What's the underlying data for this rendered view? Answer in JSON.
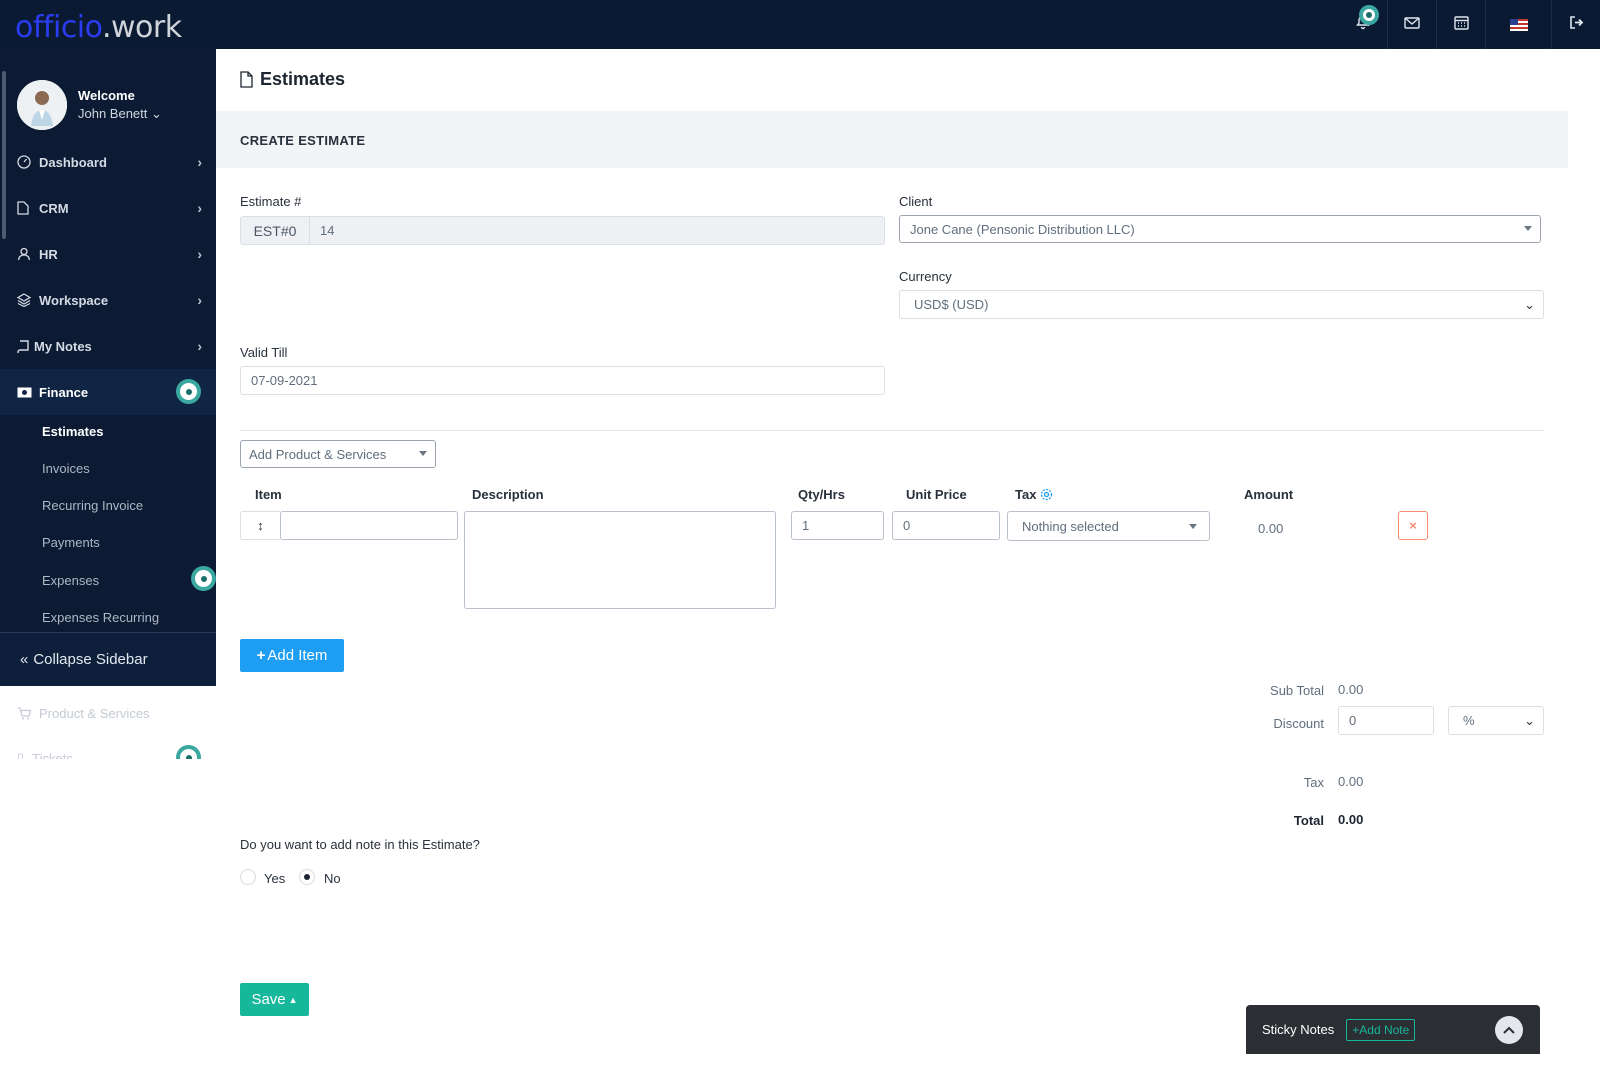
{
  "brand": {
    "logo_part1": "officio",
    "logo_part2": ".work"
  },
  "topbar": {
    "icons": [
      "bell-icon",
      "mail-icon",
      "calendar-icon",
      "us-flag-icon",
      "logout-icon"
    ]
  },
  "user": {
    "welcome": "Welcome",
    "name": "John Benett"
  },
  "sidebar": {
    "items": [
      {
        "label": "Dashboard",
        "icon": "gauge-icon"
      },
      {
        "label": "CRM",
        "icon": "file-icon"
      },
      {
        "label": "HR",
        "icon": "user-icon"
      },
      {
        "label": "Workspace",
        "icon": "layers-icon"
      },
      {
        "label": "My Notes",
        "icon": "book-icon"
      },
      {
        "label": "Finance",
        "icon": "money-icon"
      }
    ],
    "finance_sub": [
      "Estimates",
      "Invoices",
      "Recurring Invoice",
      "Payments",
      "Expenses",
      "Expenses Recurring"
    ],
    "collapse_label": "Collapse Sidebar",
    "below": [
      {
        "label": "Product & Services",
        "icon": "cart-icon"
      },
      {
        "label": "Tickets",
        "icon": "ticket-icon"
      }
    ]
  },
  "page": {
    "title": "Estimates",
    "section": "CREATE ESTIMATE"
  },
  "form": {
    "estimate_label": "Estimate #",
    "estimate_prefix": "EST#0",
    "estimate_number": "14",
    "client_label": "Client",
    "client_value": "Jone Cane (Pensonic Distribution LLC)",
    "currency_label": "Currency",
    "currency_value": "USD$ (USD)",
    "valid_till_label": "Valid Till",
    "valid_till_value": "07-09-2021",
    "add_product_placeholder": "Add Product & Services"
  },
  "items_table": {
    "headers": {
      "item": "Item",
      "description": "Description",
      "qty": "Qty/Hrs",
      "unit_price": "Unit Price",
      "tax": "Tax",
      "amount": "Amount"
    },
    "row": {
      "qty": "1",
      "unit_price": "0",
      "tax": "Nothing selected",
      "amount": "0.00"
    },
    "add_item_label": "Add Item"
  },
  "totals": {
    "subtotal_label": "Sub Total",
    "subtotal_value": "0.00",
    "discount_label": "Discount",
    "discount_value": "0",
    "discount_type": "%",
    "tax_label": "Tax",
    "tax_value": "0.00",
    "total_label": "Total",
    "total_value": "0.00"
  },
  "note": {
    "question": "Do you want to add note in this Estimate?",
    "yes": "Yes",
    "no": "No",
    "selected": "No"
  },
  "save_label": "Save",
  "sticky": {
    "title": "Sticky Notes",
    "add_label": "Add Note"
  },
  "colors": {
    "navy": "#0a1a33",
    "sidebar": "#0c1a33",
    "primary": "#1d9ef2",
    "success": "#16b79a",
    "danger": "#f28d6f",
    "accent_ring": "#3aa7a0"
  }
}
